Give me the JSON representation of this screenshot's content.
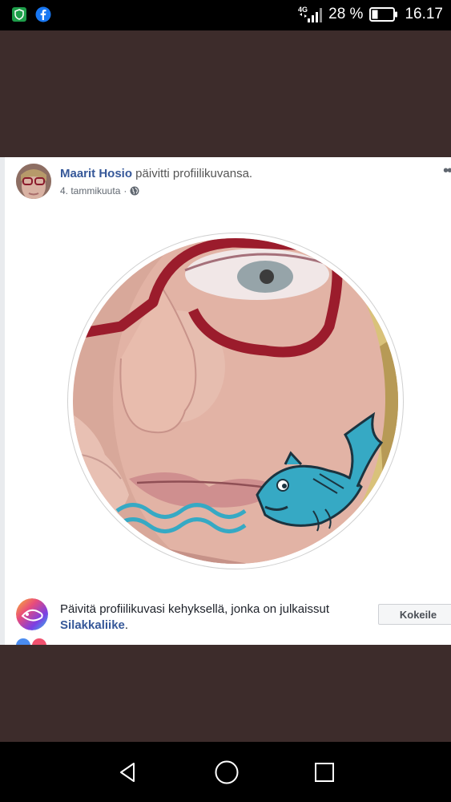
{
  "status_bar": {
    "network": "4G",
    "battery_percent": "28 %",
    "battery_level": 0.28,
    "time": "16.17",
    "icons": [
      "shield-app-icon",
      "facebook-icon",
      "signal-icon",
      "battery-icon"
    ]
  },
  "post": {
    "author": "Maarit Hosio",
    "action": " päivitti profiilikuvansa.",
    "date": "4. tammikuuta",
    "separator": " · ",
    "privacy_icon": "globe-icon",
    "more_icon": "more-options-icon"
  },
  "frame_promo": {
    "text": "Päivitä profiilikuvasi kehyksellä, jonka on julkaissut ",
    "link": "Silakkaliike",
    "suffix": ".",
    "button_label": "Kokeile"
  },
  "nav_bar": {
    "icons": [
      "back-icon",
      "home-icon",
      "recents-icon"
    ]
  },
  "colors": {
    "background": "#3d2c2b",
    "link": "#365899",
    "frame_accent": "#36a9c4",
    "glasses": "#9b1c2c"
  }
}
